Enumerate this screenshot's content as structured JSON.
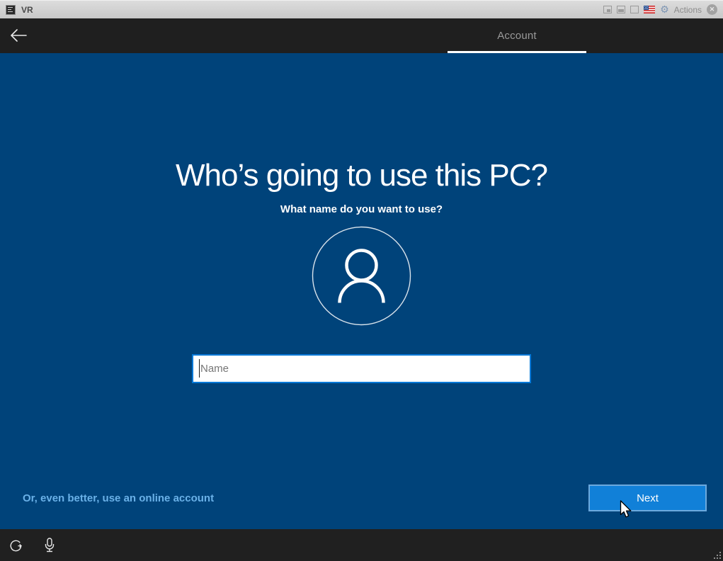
{
  "titlebar": {
    "title": "VR",
    "actions_label": "Actions"
  },
  "header": {
    "tab_label": "Account"
  },
  "main": {
    "title": "Who’s going to use this PC?",
    "subtitle": "What name do you want to use?",
    "input": {
      "value": "",
      "placeholder": "Name"
    },
    "link_label": "Or, even better, use an online account",
    "next_label": "Next"
  },
  "icons": {
    "gear": "⚙",
    "close": "✕"
  },
  "colors": {
    "page_background": "#00437a",
    "header_background": "#1f1f1f",
    "accent_blue": "#0078d7",
    "link_blue": "#6ab1e8",
    "tab_text": "#9a9a9a",
    "title_text": "#ffffff"
  }
}
